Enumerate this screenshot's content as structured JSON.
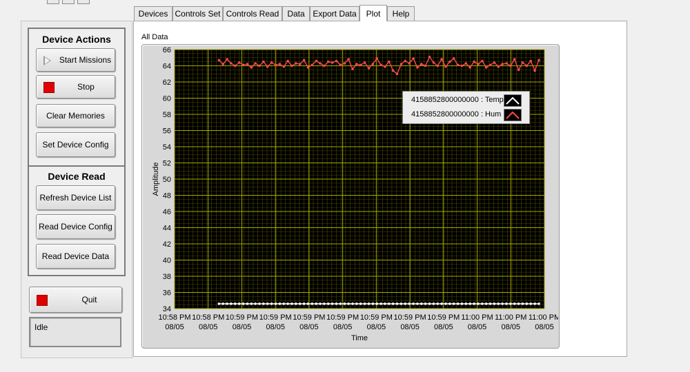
{
  "tabs": [
    "Devices",
    "Controls Set",
    "Controls Read",
    "Data",
    "Export Data",
    "Plot",
    "Help"
  ],
  "active_tab": "Plot",
  "device_actions": {
    "title": "Device Actions",
    "start_label": "Start Missions",
    "stop_label": "Stop",
    "clear_label": "Clear Memories",
    "set_config_label": "Set Device Config"
  },
  "device_read": {
    "title": "Device Read",
    "refresh_label": "Refresh Device List",
    "read_config_label": "Read Device Config",
    "read_data_label": "Read Device Data"
  },
  "quit_label": "Quit",
  "status_text": "Idle",
  "graph_title": "All Data",
  "legend": [
    {
      "label": "4158852800000000 : Temp",
      "color": "#ffffff"
    },
    {
      "label": "4158852800000000 : Hum",
      "color": "#ff4a4a"
    }
  ],
  "colors": {
    "plot_bg": "#000000",
    "grid_major": "#a8a800",
    "grid_minor": "#4a4a00",
    "stop_red": "#e00000"
  },
  "chart_data": {
    "type": "line",
    "xlabel": "Time",
    "ylabel": "Amplitude",
    "ylim": [
      34,
      66
    ],
    "yticks": [
      34,
      36,
      38,
      40,
      42,
      44,
      46,
      48,
      50,
      52,
      54,
      56,
      58,
      60,
      62,
      64,
      66
    ],
    "xticks": [
      [
        "10:58 PM",
        "08/05"
      ],
      [
        "10:58 PM",
        "08/05"
      ],
      [
        "10:59 PM",
        "08/05"
      ],
      [
        "10:59 PM",
        "08/05"
      ],
      [
        "10:59 PM",
        "08/05"
      ],
      [
        "10:59 PM",
        "08/05"
      ],
      [
        "10:59 PM",
        "08/05"
      ],
      [
        "10:59 PM",
        "08/05"
      ],
      [
        "10:59 PM",
        "08/05"
      ],
      [
        "11:00 PM",
        "08/05"
      ],
      [
        "11:00 PM",
        "08/05"
      ],
      [
        "11:00 PM",
        "08/05"
      ]
    ],
    "grid": true,
    "legend_position": "top-right",
    "series": [
      {
        "name": "4158852800000000 : Temp",
        "values": [
          34.6,
          34.6,
          34.6,
          34.6,
          34.6,
          34.6,
          34.6,
          34.6,
          34.6,
          34.6,
          34.6,
          34.6,
          34.6,
          34.6,
          34.6,
          34.6,
          34.6,
          34.6,
          34.6,
          34.6,
          34.6,
          34.6,
          34.6,
          34.6,
          34.6,
          34.6,
          34.6,
          34.6,
          34.6,
          34.6,
          34.6,
          34.6,
          34.6,
          34.6,
          34.6,
          34.6,
          34.6,
          34.6,
          34.6,
          34.6,
          34.6,
          34.6,
          34.6,
          34.6,
          34.6,
          34.6,
          34.6,
          34.6,
          34.6,
          34.6,
          34.6,
          34.6,
          34.6,
          34.6,
          34.6,
          34.6,
          34.6,
          34.6,
          34.6,
          34.6,
          34.6,
          34.6,
          34.6,
          34.6,
          34.6,
          34.6,
          34.6,
          34.6,
          34.6,
          34.6,
          34.6,
          34.6,
          34.6,
          34.6,
          34.6,
          34.6,
          34.6,
          34.6,
          34.6,
          34.6
        ]
      },
      {
        "name": "4158852800000000 : Hum",
        "values": [
          64.7,
          64.2,
          64.8,
          64.3,
          64.0,
          64.4,
          64.1,
          64.2,
          63.8,
          64.3,
          64.0,
          64.5,
          63.9,
          64.4,
          64.1,
          64.2,
          63.9,
          64.6,
          64.0,
          64.3,
          64.2,
          64.7,
          63.8,
          64.1,
          64.6,
          64.3,
          64.0,
          64.5,
          64.4,
          64.6,
          64.1,
          64.3,
          64.8,
          63.6,
          64.2,
          64.1,
          64.4,
          63.7,
          64.2,
          64.9,
          64.1,
          63.9,
          64.5,
          63.4,
          63.0,
          64.2,
          64.6,
          64.3,
          64.9,
          63.8,
          64.2,
          64.0,
          65.1,
          64.4,
          64.0,
          64.8,
          63.9,
          64.5,
          64.9,
          64.1,
          64.0,
          64.3,
          63.8,
          64.5,
          64.2,
          64.6,
          63.8,
          64.1,
          64.4,
          63.9,
          64.2,
          64.3,
          64.0,
          64.8,
          63.5,
          64.4,
          64.0,
          64.6,
          63.4,
          64.7
        ]
      }
    ]
  }
}
